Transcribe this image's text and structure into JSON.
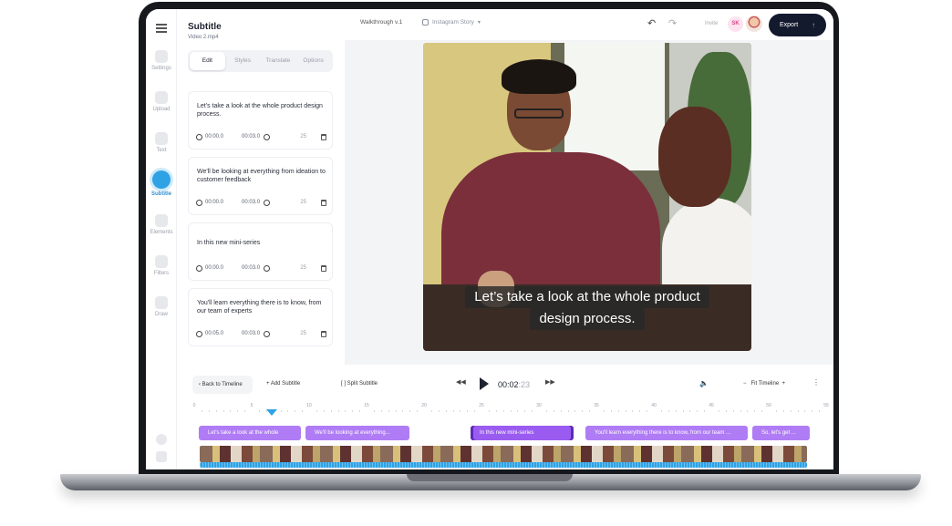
{
  "sidebar": {
    "items": [
      {
        "label": "Settings"
      },
      {
        "label": "Upload"
      },
      {
        "label": "Text"
      },
      {
        "label": "Subtitle"
      },
      {
        "label": "Elements"
      },
      {
        "label": "Filters"
      },
      {
        "label": "Draw"
      }
    ]
  },
  "panel": {
    "title": "Subtitle",
    "file": "Video 2.mp4",
    "tabs": [
      "Edit",
      "Styles",
      "Translate",
      "Options"
    ],
    "cards": [
      {
        "text": "Let's take a look at the whole product design process.",
        "start": "00:00.0",
        "end": "00:03.0",
        "num": "25"
      },
      {
        "text": "We'll be looking at everything from ideation to customer feedback",
        "start": "00:00.0",
        "end": "00:03.0",
        "num": "25"
      },
      {
        "text": "In this new mini-series",
        "start": "00:00.0",
        "end": "00:03.0",
        "num": "25"
      },
      {
        "text": "You'll learn everything there is to know, from our team of experts",
        "start": "00:05.0",
        "end": "00:03.0",
        "num": "25"
      }
    ]
  },
  "header": {
    "project": "Walkthrough v.1",
    "story": "Instagram Story",
    "invite": "Invite",
    "avatar_initials": "SK",
    "export": "Export"
  },
  "preview": {
    "caption_line1": "Let’s take a look at the whole product",
    "caption_line2": "design process."
  },
  "timeline": {
    "back": "Back to Timeline",
    "add": "Add Subtitle",
    "split": "Split Subtitle",
    "time_main": "00:02",
    "time_frames": ":23",
    "fit": "Fit Timeline",
    "ticks": [
      "0",
      "5",
      "10",
      "15",
      "20",
      "25",
      "30",
      "35",
      "40",
      "45",
      "50",
      "55"
    ],
    "clips": [
      "Let's take a look at the whole",
      "We'll be looking at everything...",
      "In this new mini-series",
      "You'll learn everything there is to know, from our team ...",
      "So, let's get ..."
    ]
  },
  "colors": {
    "accent": "#2fa2e6",
    "clip": "#b07cf5",
    "export_bg": "#141a2e"
  }
}
